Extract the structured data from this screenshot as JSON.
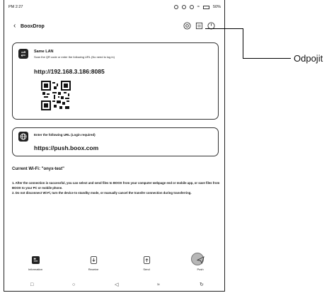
{
  "status": {
    "time": "PM 2:27",
    "battery": "50%"
  },
  "header": {
    "back_icon": "chevron-left-icon",
    "title": "BooxDrop"
  },
  "same_lan": {
    "title": "Same LAN",
    "subtitle": "Scan the QR code or enter the following URL (No need to log in)",
    "url": "http://192.168.3.186:8085"
  },
  "push_card": {
    "title": "Enter the following URL (Login required)",
    "url": "https://push.boox.com"
  },
  "wifi": {
    "label": "Current Wi-Fi: \"onyx-test\""
  },
  "notes": {
    "n1": "1. After the connection is successful, you can select and send files to BOOX from your computer webpage end or mobile app, or save files from BOOX to your PC or mobile phone.",
    "n2": "2. Do not disconnect Wi-Fi, turn the device to standby mode, or manually cancel the transfer connection during transferring."
  },
  "tabs": [
    {
      "label": "Information",
      "icon": "information-icon"
    },
    {
      "label": "Receive",
      "icon": "receive-icon"
    },
    {
      "label": "Send",
      "icon": "send-icon"
    },
    {
      "label": "Push",
      "icon": "push-icon"
    }
  ],
  "callout": {
    "label": "Odpojit"
  }
}
